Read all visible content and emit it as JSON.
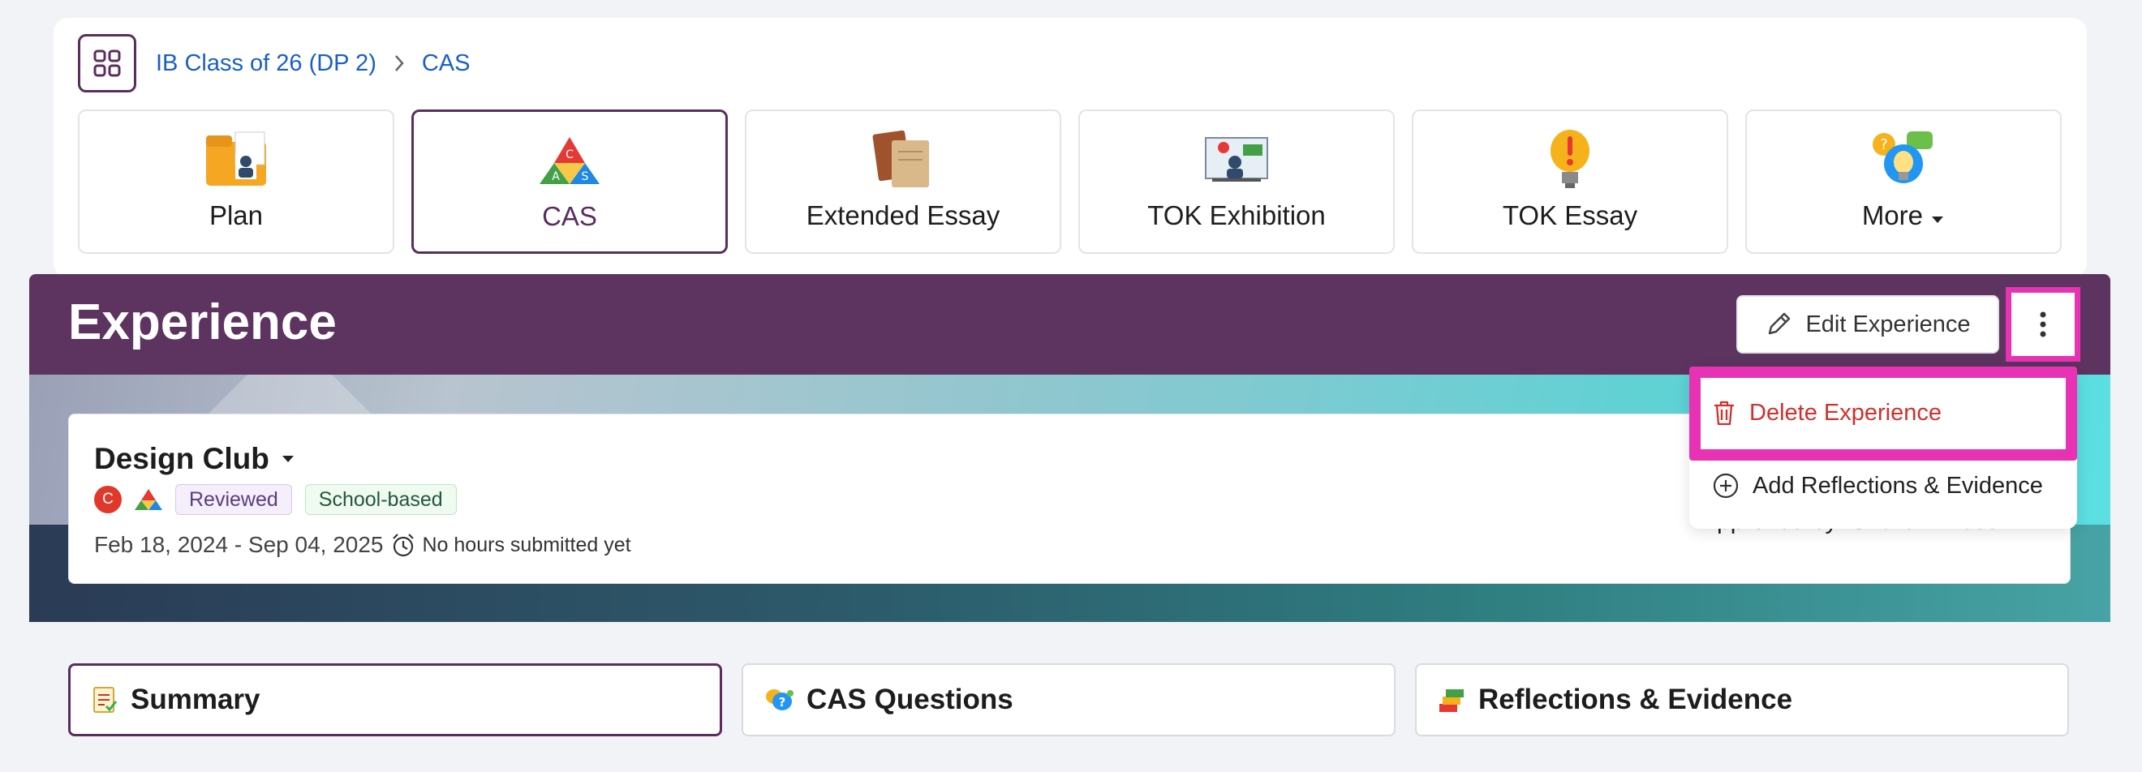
{
  "breadcrumb": {
    "class_name": "IB Class of 26 (DP 2)",
    "current": "CAS"
  },
  "nav_tiles": [
    {
      "label": "Plan",
      "icon": "folder-person-icon"
    },
    {
      "label": "CAS",
      "icon": "cas-triangle-icon"
    },
    {
      "label": "Extended Essay",
      "icon": "books-icon"
    },
    {
      "label": "TOK Exhibition",
      "icon": "presentation-icon"
    },
    {
      "label": "TOK Essay",
      "icon": "lightbulb-icon"
    },
    {
      "label": "More",
      "icon": "ideas-icon"
    }
  ],
  "header": {
    "title": "Experience",
    "edit_label": "Edit Experience"
  },
  "experience": {
    "title": "Design Club",
    "badge_letter": "C",
    "tags": [
      "Reviewed",
      "School-based"
    ],
    "date_range": "Feb 18, 2024 - Sep 04, 2025",
    "hours": "No hours submitted yet",
    "approved_label": "Approved by:",
    "approved_name": "Sharon Press"
  },
  "menu": {
    "delete_label": "Delete Experience",
    "add_label": "Add Reflections & Evidence"
  },
  "tabs": [
    {
      "label": "Summary"
    },
    {
      "label": "CAS Questions"
    },
    {
      "label": "Reflections & Evidence"
    }
  ],
  "colors": {
    "brand_purple": "#5c345f",
    "highlight_pink": "#e832b4",
    "danger_red": "#d1302b",
    "link_blue": "#1a5fc7"
  }
}
